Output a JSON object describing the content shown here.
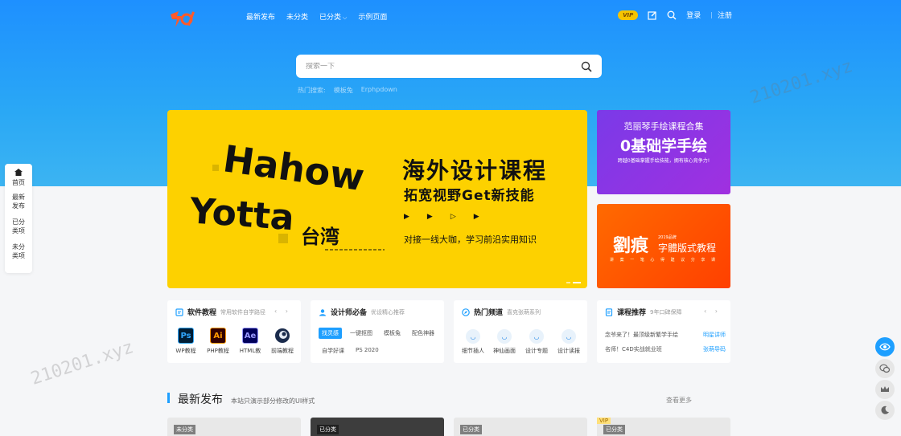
{
  "header": {
    "nav": [
      "最新发布",
      "未分类",
      "已分类",
      "示例页面"
    ],
    "vip": "VIP",
    "login": "登录",
    "separator": "|",
    "register": "注册"
  },
  "search": {
    "placeholder": "搜索一下",
    "hot_label": "热门搜索:",
    "hot": [
      "模板兔",
      "Erphpdown"
    ]
  },
  "banner": {
    "title": "海外设计课程",
    "subtitle": "拓宽视野Get新技能",
    "tagline": "对接一线大咖，学习前沿实用知识",
    "art_text_1": "Hahow",
    "art_text_2": "Yotta",
    "art_text_3": "台湾"
  },
  "side_cards": {
    "purple": {
      "line1": "范丽琴手绘课程合集",
      "line2": "0基础学手绘",
      "line3": "跨越0基础掌握手绘技能，拥有核心竞争力!"
    },
    "orange": {
      "big": "劉痕",
      "year": "2019品牌",
      "title": "字體版式教程",
      "sub": "讲 案 一 笔 心 得 建 议 分 享 课"
    }
  },
  "left_nav": {
    "home": "首页",
    "latest": [
      "最新",
      "发布"
    ],
    "classified": [
      "已分",
      "类项"
    ],
    "unclassified": [
      "未分",
      "类项"
    ]
  },
  "tiles": {
    "software": {
      "title": "软件教程",
      "sub": "常用软件自学路径",
      "items": [
        {
          "abbr": "Ps",
          "label": "WP教程"
        },
        {
          "abbr": "Ai",
          "label": "PHP教程"
        },
        {
          "abbr": "Ae",
          "label": "HTML教"
        },
        {
          "abbr": "C4D",
          "label": "前端教程"
        }
      ]
    },
    "designer": {
      "title": "设计师必备",
      "sub": "优设精心推荐",
      "tags": [
        "找灵感",
        "一键抠图",
        "模板兔",
        "配色神器",
        "自学好课",
        "PS 2020"
      ]
    },
    "hot": {
      "title": "热门频道",
      "sub": "喜克张萌系列",
      "items": [
        "细节插人",
        "神仙画面",
        "设计专题",
        "设计读报"
      ]
    },
    "courses": {
      "title": "课程推荐",
      "sub": "9年口碑保障",
      "rows": [
        {
          "text": "念爷来了！最顶级新繁学手绘",
          "tag": "明星讲师"
        },
        {
          "text": "名师！C4D实战就业班",
          "tag": "张萌导码"
        }
      ]
    }
  },
  "section": {
    "title": "最新发布",
    "desc": "本站只演示部分修改的UI样式",
    "more": "查看更多"
  },
  "posts": [
    {
      "category": "未分类",
      "vip": ""
    },
    {
      "category": "已分类",
      "vip": ""
    },
    {
      "category": "已分类",
      "vip": ""
    },
    {
      "category": "已分类",
      "vip": "VIP"
    }
  ],
  "watermark": "210201.xyz",
  "colors": {
    "primary": "#1e9fff",
    "banner": "#fdd100",
    "vip": "#f5c400"
  }
}
